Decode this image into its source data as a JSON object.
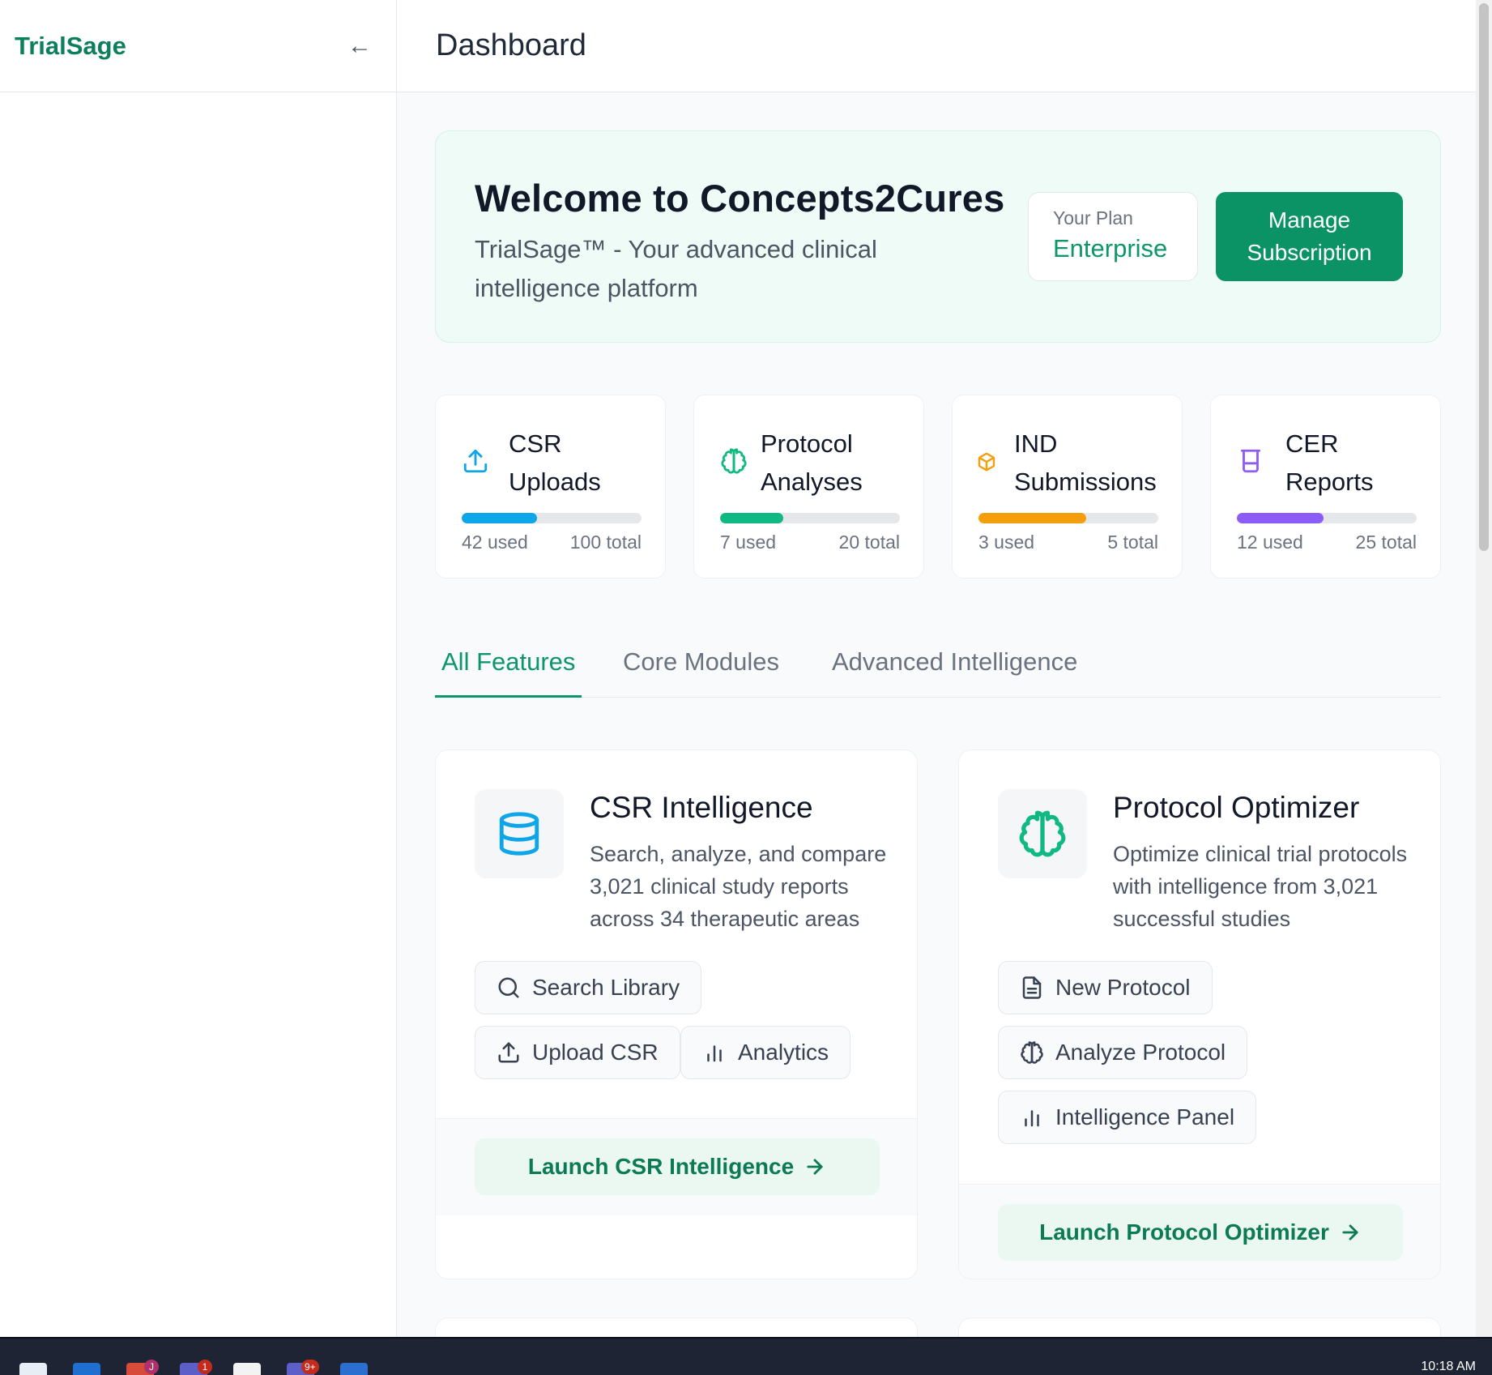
{
  "sidebar": {
    "brand": "TrialSage",
    "collapse_icon": "arrow-left-icon",
    "collapse_glyph": "←"
  },
  "header": {
    "title": "Dashboard"
  },
  "welcome": {
    "title": "Welcome to Concepts2Cures",
    "subtitle": "TrialSage™ - Your advanced clinical intelligence platform",
    "plan_label": "Your Plan",
    "plan_value": "Enterprise",
    "manage_button": "Manage Subscription"
  },
  "stats": [
    {
      "title": "CSR Uploads",
      "used": "42 used",
      "total": "100 total",
      "fraction": 0.42,
      "color": "#0ea5e9",
      "icon": "upload-icon"
    },
    {
      "title": "Protocol Analyses",
      "used": "7 used",
      "total": "20 total",
      "fraction": 0.35,
      "color": "#10b981",
      "icon": "brain-icon"
    },
    {
      "title": "IND Submissions",
      "used": "3 used",
      "total": "5 total",
      "fraction": 0.6,
      "color": "#f59e0b",
      "icon": "package-icon"
    },
    {
      "title": "CER Reports",
      "used": "12 used",
      "total": "25 total",
      "fraction": 0.48,
      "color": "#8b5cf6",
      "icon": "beaker-icon"
    }
  ],
  "tabs": [
    "All Features",
    "Core Modules",
    "Advanced Intelligence"
  ],
  "features": [
    {
      "title": "CSR Intelligence",
      "description": "Search, analyze, and compare 3,021 clinical study reports across 34 therapeutic areas",
      "icon": "database-icon",
      "icon_color": "#0ea5e9",
      "actions": [
        "Search Library",
        "Upload CSR",
        "Analytics"
      ],
      "launch": "Launch CSR Intelligence"
    },
    {
      "title": "Protocol Optimizer",
      "description": "Optimize clinical trial protocols with intelligence from 3,021 successful studies",
      "icon": "brain-icon",
      "icon_color": "#10b981",
      "actions": [
        "New Protocol",
        "Analyze Protocol",
        "Intelligence Panel"
      ],
      "launch": "Launch Protocol Optimizer"
    }
  ],
  "taskbar": {
    "badges": [
      "J",
      "1",
      "9+"
    ],
    "clock": "10:18 AM"
  },
  "colors": {
    "accent": "#0d9668",
    "brand": "#0d7f5c",
    "welcome_bg": "#effbf6"
  }
}
